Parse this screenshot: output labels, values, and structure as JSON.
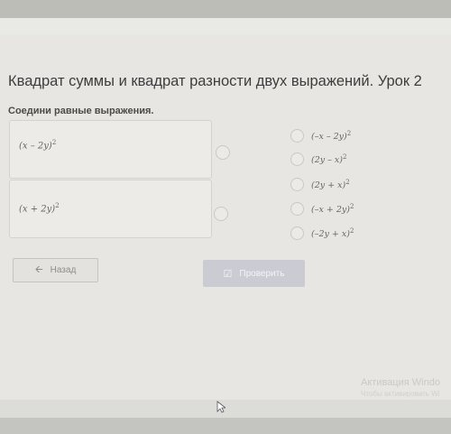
{
  "lesson": {
    "title": "Квадрат суммы и квадрат разности двух выражений. Урок 2",
    "instruction": "Соедини равные выражения."
  },
  "left_items": [
    {
      "base": "(x – 2y)",
      "exp": "2"
    },
    {
      "base": "(x + 2y)",
      "exp": "2"
    }
  ],
  "right_items": [
    {
      "base": "(–x – 2y)",
      "exp": "2"
    },
    {
      "base": "(2y – x)",
      "exp": "2"
    },
    {
      "base": "(2y + x)",
      "exp": "2"
    },
    {
      "base": "(–x + 2y)",
      "exp": "2"
    },
    {
      "base": "(–2y + x)",
      "exp": "2"
    }
  ],
  "buttons": {
    "back_label": "Назад",
    "check_label": "Проверить"
  },
  "watermark": {
    "line1": "Активация Windo",
    "line2": "Чтобы активировать Wi"
  },
  "icons": {
    "back": "arrow-left-icon",
    "check": "check-icon"
  }
}
